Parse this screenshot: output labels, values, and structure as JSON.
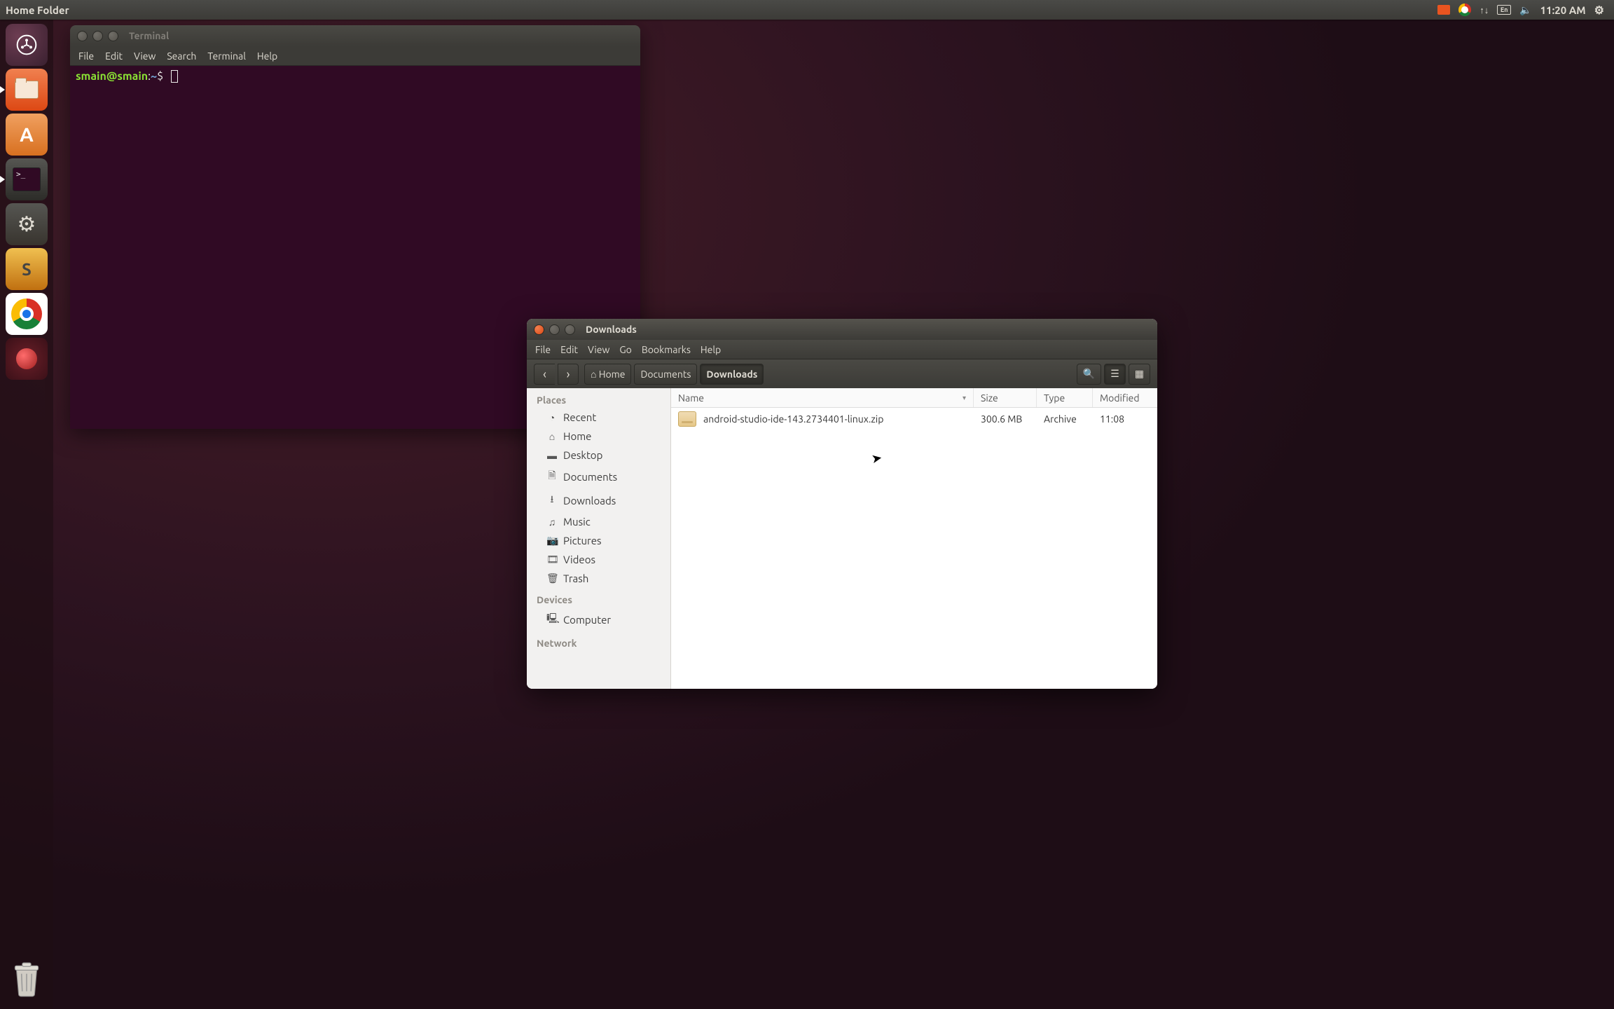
{
  "menubar": {
    "title": "Home Folder",
    "kb_layout": "En",
    "time": "11:20 AM"
  },
  "terminal": {
    "title": "Terminal",
    "menu": [
      "File",
      "Edit",
      "View",
      "Search",
      "Terminal",
      "Help"
    ],
    "user": "smain",
    "host": "smain",
    "path_sym": "~",
    "prompt_sym": "$"
  },
  "nautilus": {
    "title": "Downloads",
    "menu": [
      "File",
      "Edit",
      "View",
      "Go",
      "Bookmarks",
      "Help"
    ],
    "breadcrumb": {
      "home": "Home",
      "mid": "Documents",
      "current": "Downloads"
    },
    "sidebar": {
      "places_header": "Places",
      "devices_header": "Devices",
      "network_header": "Network",
      "places": [
        {
          "icon": "◔",
          "label": "Recent"
        },
        {
          "icon": "⌂",
          "label": "Home"
        },
        {
          "icon": "▬",
          "label": "Desktop"
        },
        {
          "icon": "🗎",
          "label": "Documents"
        },
        {
          "icon": "⭳",
          "label": "Downloads"
        },
        {
          "icon": "♫",
          "label": "Music"
        },
        {
          "icon": "📷",
          "label": "Pictures"
        },
        {
          "icon": "🎞",
          "label": "Videos"
        },
        {
          "icon": "🗑",
          "label": "Trash"
        }
      ],
      "devices": [
        {
          "icon": "🖳",
          "label": "Computer"
        }
      ]
    },
    "columns": {
      "name": "Name",
      "size": "Size",
      "type": "Type",
      "modified": "Modified"
    },
    "file": {
      "name": "android-studio-ide-143.2734401-linux.zip",
      "size": "300.6 MB",
      "type": "Archive",
      "modified": "11:08"
    }
  }
}
